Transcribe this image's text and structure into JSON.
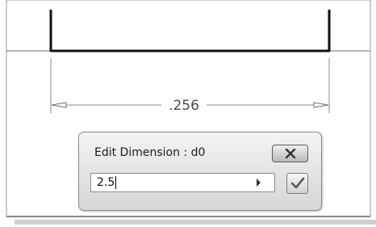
{
  "dimension": {
    "value_label": ".256"
  },
  "dialog": {
    "title": "Edit Dimension : d0",
    "input_value": "2.5",
    "close_icon": "close-icon",
    "accept_icon": "checkmark-icon",
    "dropdown_icon": "arrow-right-icon"
  },
  "colors": {
    "sketch_line": "#111111",
    "dimension_line": "#808080",
    "dialog_bg": "#e3e3e3",
    "close_x": "#3a3a3a",
    "checkmark": "#5a5a5a"
  }
}
